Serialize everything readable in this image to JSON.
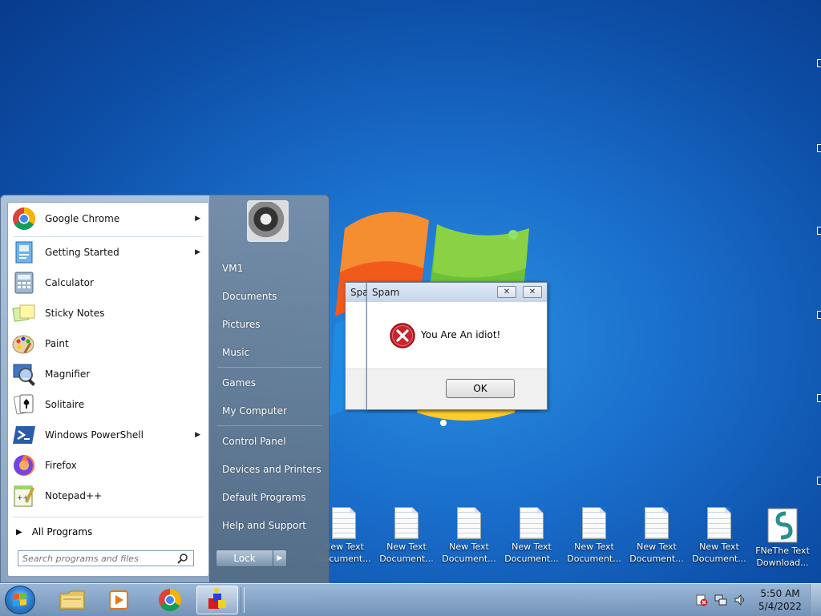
{
  "start_menu": {
    "programs": [
      {
        "label": "Google Chrome",
        "icon": "chrome-icon",
        "has_submenu": true
      },
      {
        "label": "Getting Started",
        "icon": "getting-started-icon",
        "has_submenu": true
      },
      {
        "label": "Calculator",
        "icon": "calculator-icon",
        "has_submenu": false
      },
      {
        "label": "Sticky Notes",
        "icon": "sticky-notes-icon",
        "has_submenu": false
      },
      {
        "label": "Paint",
        "icon": "paint-icon",
        "has_submenu": false
      },
      {
        "label": "Magnifier",
        "icon": "magnifier-icon",
        "has_submenu": false
      },
      {
        "label": "Solitaire",
        "icon": "solitaire-icon",
        "has_submenu": false
      },
      {
        "label": "Windows PowerShell",
        "icon": "powershell-icon",
        "has_submenu": true
      },
      {
        "label": "Firefox",
        "icon": "firefox-icon",
        "has_submenu": false
      },
      {
        "label": "Notepad++",
        "icon": "notepad-plus-plus-icon",
        "has_submenu": false
      }
    ],
    "all_programs": "All Programs",
    "search_placeholder": "Search programs and files",
    "right_items": {
      "user": "VM1",
      "documents": "Documents",
      "pictures": "Pictures",
      "music": "Music",
      "games": "Games",
      "computer": "My Computer",
      "control_panel": "Control Panel",
      "devices": "Devices and Printers",
      "defaults": "Default Programs",
      "help": "Help and Support"
    },
    "lock_label": "Lock"
  },
  "dialog_back": {
    "title": "Spam"
  },
  "dialog_front": {
    "title": "Spam",
    "message": "You Are An idiot!",
    "ok_label": "OK"
  },
  "desktop_icons": [
    {
      "line1": "New Text",
      "line2": "Document..."
    },
    {
      "line1": "New Text",
      "line2": "Document..."
    },
    {
      "line1": "New Text",
      "line2": "Document..."
    },
    {
      "line1": "New Text",
      "line2": "Document..."
    },
    {
      "line1": "New Text",
      "line2": "Document..."
    },
    {
      "line1": "New Text",
      "line2": "Document..."
    },
    {
      "line1": "New Text",
      "line2": "Document..."
    },
    {
      "line1": "FNeThe Text",
      "line2": "Download..."
    }
  ],
  "taskbar": {
    "time": "5:50 AM",
    "date": "5/4/2022"
  },
  "colors": {
    "desktop": "#1a6fcc",
    "error_red": "#c8232c"
  }
}
